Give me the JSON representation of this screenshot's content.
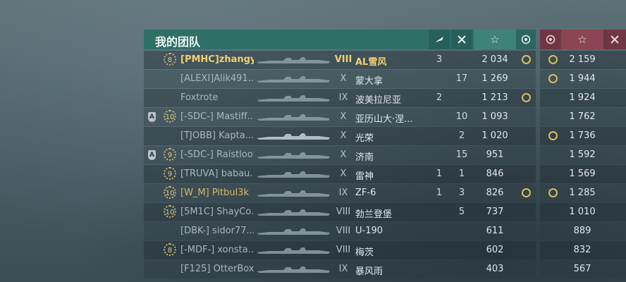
{
  "team_title": "我的团队",
  "header_icons": [
    "plane-kills-icon",
    "ship-kills-icon",
    "star-icon",
    "emblem-icon"
  ],
  "header2_icons": [
    "emblem-icon",
    "star-icon",
    "ribbon-icon"
  ],
  "players": [
    {
      "badge": "",
      "level": "8",
      "name": "[PMHC]zhangy...",
      "tier": "VIII",
      "ship": "AL雪风",
      "planes": "3",
      "kills": "",
      "exp": "2 034",
      "emblem": true,
      "emblem2": true,
      "exp2": "2 159",
      "me": true
    },
    {
      "badge": "",
      "level": "",
      "name": "[ALEXI]Alik491...",
      "tier": "X",
      "ship": "蒙大拿",
      "planes": "",
      "kills": "17",
      "exp": "1 269",
      "emblem": false,
      "emblem2": true,
      "exp2": "1 944"
    },
    {
      "badge": "",
      "level": "",
      "name": "Foxtrote",
      "tier": "IX",
      "ship": "波美拉尼亚",
      "planes": "2",
      "kills": "",
      "exp": "1 213",
      "emblem": true,
      "emblem2": false,
      "exp2": "1 924"
    },
    {
      "badge": "A",
      "level": "10",
      "name": "[-SDC-] Mastiff...",
      "tier": "X",
      "ship": "亚历山大·涅...",
      "planes": "",
      "kills": "10",
      "exp": "1 093",
      "emblem": false,
      "emblem2": false,
      "exp2": "1 762"
    },
    {
      "badge": "",
      "level": "",
      "name": "[TJOBB] Kapta...",
      "tier": "X",
      "ship": "光荣",
      "planes": "",
      "kills": "2",
      "exp": "1 020",
      "emblem": false,
      "emblem2": true,
      "exp2": "1 736"
    },
    {
      "badge": "A",
      "level": "9",
      "name": "[-SDC-] Raistloof",
      "tier": "X",
      "ship": "济南",
      "planes": "",
      "kills": "15",
      "exp": "951",
      "emblem": false,
      "emblem2": false,
      "exp2": "1 592"
    },
    {
      "badge": "",
      "level": "9",
      "name": "[TRUVA] babau...",
      "tier": "X",
      "ship": "雷神",
      "planes": "1",
      "kills": "1",
      "exp": "846",
      "emblem": false,
      "emblem2": false,
      "exp2": "1 569"
    },
    {
      "badge": "",
      "level": "10",
      "name": "[W_M] Pitbul3k",
      "tier": "IX",
      "ship": "ZF-6",
      "planes": "1",
      "kills": "3",
      "exp": "826",
      "emblem": true,
      "emblem2": true,
      "exp2": "1 285",
      "div": true
    },
    {
      "badge": "",
      "level": "10",
      "name": "[5M1C] ShayCo...",
      "tier": "VIII",
      "ship": "勃兰登堡",
      "planes": "",
      "kills": "5",
      "exp": "737",
      "emblem": false,
      "emblem2": false,
      "exp2": "1 010"
    },
    {
      "badge": "",
      "level": "",
      "name": "[DBK-] sidor77...",
      "tier": "VIII",
      "ship": "U-190",
      "planes": "",
      "kills": "",
      "exp": "611",
      "emblem": false,
      "emblem2": false,
      "exp2": "889"
    },
    {
      "badge": "",
      "level": "8",
      "name": "[-MDF-] xonsta...",
      "tier": "VIII",
      "ship": "梅茨",
      "planes": "",
      "kills": "",
      "exp": "602",
      "emblem": false,
      "emblem2": false,
      "exp2": "832"
    },
    {
      "badge": "",
      "level": "",
      "name": "[F125] OtterBox...",
      "tier": "IX",
      "ship": "暴风雨",
      "planes": "",
      "kills": "",
      "exp": "403",
      "emblem": false,
      "emblem2": false,
      "exp2": "567"
    }
  ]
}
